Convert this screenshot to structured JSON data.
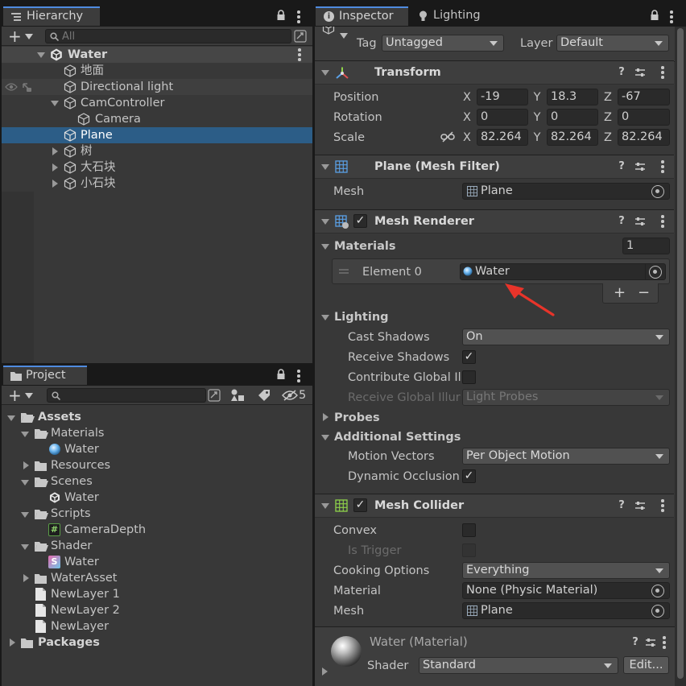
{
  "hierarchy": {
    "tab_label": "Hierarchy",
    "search_placeholder": "All",
    "scene_name": "Water",
    "items": [
      {
        "label": "地面"
      },
      {
        "label": "Directional light"
      },
      {
        "label": "CamController"
      },
      {
        "label": "Camera"
      },
      {
        "label": "Plane"
      },
      {
        "label": "树"
      },
      {
        "label": "大石块"
      },
      {
        "label": "小石块"
      }
    ]
  },
  "project": {
    "tab_label": "Project",
    "hidden_count": "5",
    "items": [
      {
        "label": "Assets"
      },
      {
        "label": "Materials"
      },
      {
        "label": "Water"
      },
      {
        "label": "Resources"
      },
      {
        "label": "Scenes"
      },
      {
        "label": "Water"
      },
      {
        "label": "Scripts"
      },
      {
        "label": "CameraDepth"
      },
      {
        "label": "Shader"
      },
      {
        "label": "Water"
      },
      {
        "label": "WaterAsset"
      },
      {
        "label": "NewLayer 1"
      },
      {
        "label": "NewLayer 2"
      },
      {
        "label": "NewLayer"
      },
      {
        "label": "Packages"
      }
    ]
  },
  "inspector": {
    "tab_label": "Inspector",
    "lighting_tab_label": "Lighting",
    "tag_label": "Tag",
    "tag_value": "Untagged",
    "layer_label": "Layer",
    "layer_value": "Default",
    "transform": {
      "title": "Transform",
      "position_label": "Position",
      "rotation_label": "Rotation",
      "scale_label": "Scale",
      "axis_x": "X",
      "axis_y": "Y",
      "axis_z": "Z",
      "position": [
        "-19",
        "18.3",
        "-67"
      ],
      "rotation": [
        "0",
        "0",
        "0"
      ],
      "scale": [
        "82.264",
        "82.264",
        "82.264"
      ]
    },
    "mesh_filter": {
      "title": "Plane (Mesh Filter)",
      "mesh_label": "Mesh",
      "mesh_value": "Plane"
    },
    "mesh_renderer": {
      "title": "Mesh Renderer",
      "enabled": true,
      "materials_label": "Materials",
      "materials_count": "1",
      "element_label": "Element 0",
      "element_value": "Water",
      "add_label": "+",
      "remove_label": "−",
      "lighting_label": "Lighting",
      "cast_shadows_label": "Cast Shadows",
      "cast_shadows_value": "On",
      "receive_shadows_label": "Receive Shadows",
      "receive_shadows": true,
      "contribute_gi_label": "Contribute Global Il",
      "contribute_gi": false,
      "receive_gi_label": "Receive Global Illur",
      "receive_gi_value": "Light Probes",
      "probes_label": "Probes",
      "additional_label": "Additional Settings",
      "motion_vectors_label": "Motion Vectors",
      "motion_vectors_value": "Per Object Motion",
      "dynamic_occlusion_label": "Dynamic Occlusion",
      "dynamic_occlusion": true
    },
    "mesh_collider": {
      "title": "Mesh Collider",
      "enabled": true,
      "convex_label": "Convex",
      "is_trigger_label": "Is Trigger",
      "cooking_label": "Cooking Options",
      "cooking_value": "Everything",
      "material_label": "Material",
      "material_value": "None (Physic Material)",
      "mesh_label": "Mesh",
      "mesh_value": "Plane"
    },
    "material": {
      "title": "Water (Material)",
      "shader_label": "Shader",
      "shader_value": "Standard",
      "edit_label": "Edit..."
    }
  },
  "colors": {
    "selection": "#2c5d87",
    "accent_arrow": "#e8342a",
    "tab_accent": "#4f8be0"
  }
}
